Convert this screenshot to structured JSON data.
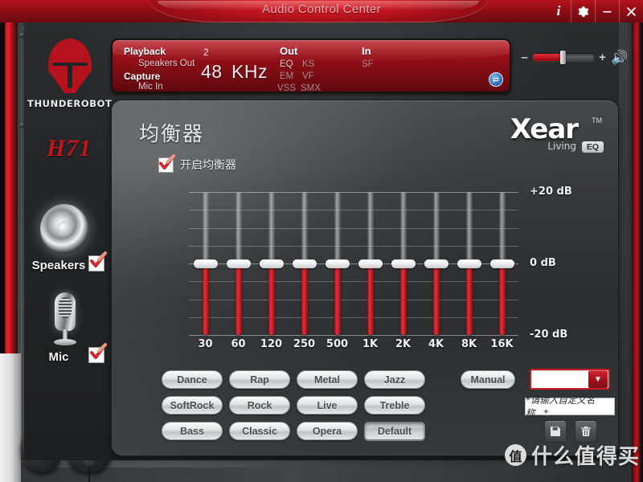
{
  "window": {
    "title": "Audio Control Center",
    "buttons": [
      {
        "name": "info",
        "glyph": "i"
      },
      {
        "name": "settings",
        "glyph": "gear-icon"
      },
      {
        "name": "minimize",
        "glyph": "minimize-icon"
      },
      {
        "name": "close",
        "glyph": "close-icon"
      }
    ]
  },
  "brand": {
    "logo_icon": "thunderobot-helm-icon",
    "name": "THUNDEROBOT",
    "model": "H71"
  },
  "devices": [
    {
      "icon": "speaker-icon",
      "label": "Speakers",
      "checked": true
    },
    {
      "icon": "microphone-icon",
      "label": "Mic",
      "checked": true
    }
  ],
  "infobar": {
    "playback_label": "Playback",
    "playback_value": "Speakers Out",
    "capture_label": "Capture",
    "capture_value": "Mic In",
    "channels": "2",
    "sample_rate": "48",
    "sample_rate_unit": "KHz",
    "out_label": "Out",
    "in_label": "In",
    "out_flags": [
      "EQ",
      "KS",
      "EM",
      "VF",
      "VSS",
      "SMX"
    ],
    "out_flags_active": [
      "EQ"
    ],
    "in_flags": [
      "SF"
    ],
    "swap_icon": "swap-arrows-icon"
  },
  "volume": {
    "minus": "–",
    "plus": "+",
    "speaker_icon": "volume-speaker-icon",
    "level_percent": 50
  },
  "panel": {
    "title": "均衡器",
    "enable_label": "开启均衡器",
    "enable_checked": true,
    "logo": {
      "word": "Xear",
      "tm": "TM",
      "living": "Living",
      "eq": "EQ"
    }
  },
  "chart_data": {
    "type": "bar",
    "title": "均衡器",
    "xlabel": "",
    "ylabel": "dB",
    "ylim": [
      -20,
      20
    ],
    "gridlines": [
      20,
      15,
      10,
      5,
      0,
      -5,
      -10,
      -15,
      -20
    ],
    "categories": [
      "30",
      "60",
      "120",
      "250",
      "500",
      "1K",
      "2K",
      "4K",
      "8K",
      "16K"
    ],
    "values": [
      0,
      0,
      0,
      0,
      0,
      0,
      0,
      0,
      0,
      0
    ],
    "axis_labels": {
      "top": "+20 dB",
      "middle": "0    dB",
      "bottom": "-20  dB"
    }
  },
  "presets": {
    "rows": [
      [
        {
          "label": "Dance",
          "selected": false
        },
        {
          "label": "Rap",
          "selected": false
        },
        {
          "label": "Metal",
          "selected": false
        },
        {
          "label": "Jazz",
          "selected": false
        }
      ],
      [
        {
          "label": "SoftRock",
          "selected": false
        },
        {
          "label": "Rock",
          "selected": false
        },
        {
          "label": "Live",
          "selected": false
        },
        {
          "label": "Treble",
          "selected": false
        }
      ],
      [
        {
          "label": "Bass",
          "selected": false
        },
        {
          "label": "Classic",
          "selected": false
        },
        {
          "label": "Opera",
          "selected": false
        },
        {
          "label": "Default",
          "selected": true
        }
      ]
    ],
    "manual_label": "Manual"
  },
  "custom": {
    "select_value": "",
    "dropdown_icon": "chevron-down-icon",
    "name_placeholder": "*请输入自定义名称...*",
    "save_icon": "save-disk-icon",
    "delete_icon": "trash-icon"
  },
  "watermark": {
    "badge": "值",
    "text": "什么值得买"
  },
  "colors": {
    "accent_red": "#c4121c",
    "title_red": "#8f0d15",
    "slider_red": "#c8202a",
    "panel_gray": "#3a3b3d"
  }
}
